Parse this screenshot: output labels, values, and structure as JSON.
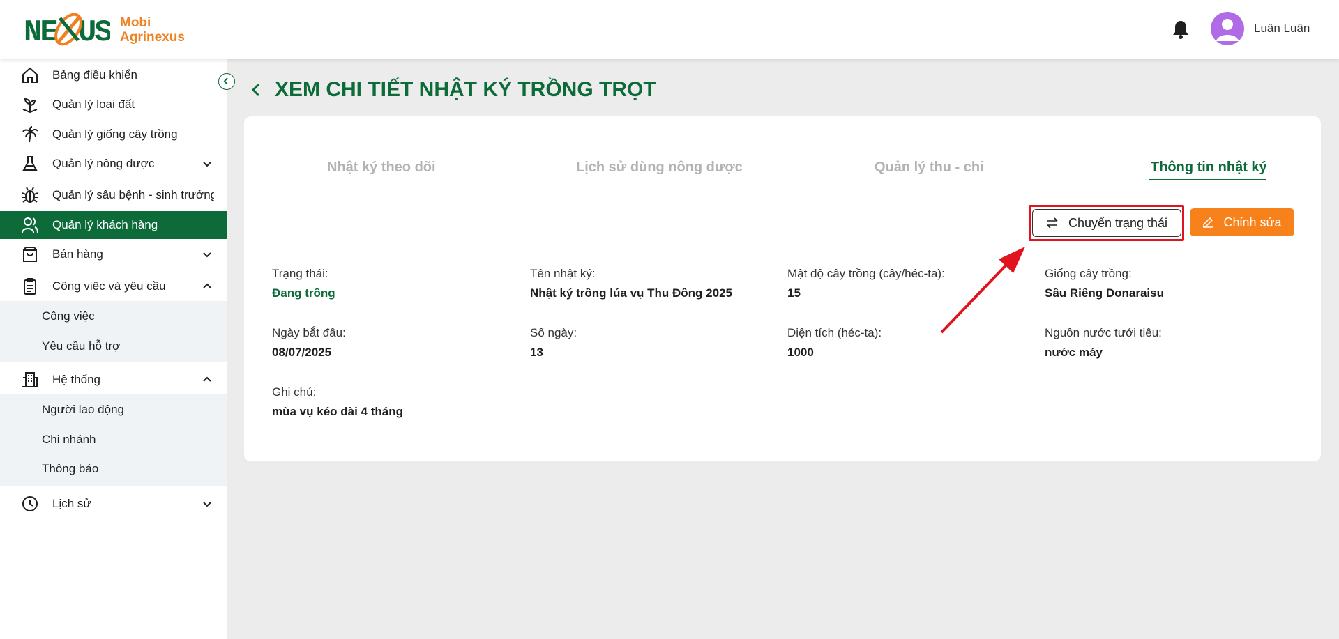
{
  "brand": {
    "name_line1": "Mobi",
    "name_line2": "Agrinexus",
    "logo_text": "NEXUS"
  },
  "user": {
    "name": "Luân Luân"
  },
  "sidebar": {
    "items": [
      {
        "label": "Bảng điều khiển",
        "icon": "home-icon"
      },
      {
        "label": "Quản lý loại đất",
        "icon": "sprout-icon"
      },
      {
        "label": "Quản lý giống cây trồng",
        "icon": "palm-tree-icon"
      },
      {
        "label": "Quản lý nông dược",
        "icon": "flask-icon",
        "has_children": true
      },
      {
        "label": "Quản lý sâu bệnh - sinh trưởng",
        "icon": "bug-icon"
      },
      {
        "label": "Quản lý khách hàng",
        "icon": "users-icon",
        "active": true
      },
      {
        "label": "Bán hàng",
        "icon": "shopping-bag-icon",
        "has_children": true
      },
      {
        "label": "Công việc và yêu cầu",
        "icon": "clipboard-icon",
        "expanded": true,
        "children": [
          "Công việc",
          "Yêu cầu hỗ trợ"
        ]
      },
      {
        "label": "Hệ thống",
        "icon": "building-icon",
        "expanded": true,
        "children": [
          "Người lao động",
          "Chi nhánh",
          "Thông báo"
        ]
      },
      {
        "label": "Lịch sử",
        "icon": "history-icon",
        "has_children": true
      }
    ]
  },
  "page": {
    "title": "XEM CHI TIẾT NHẬT KÝ TRỒNG TRỌT"
  },
  "tabs": [
    {
      "label": "Nhật ký theo dõi",
      "active": false
    },
    {
      "label": "Lịch sử dùng nông dược",
      "active": false
    },
    {
      "label": "Quản lý thu - chi",
      "active": false
    },
    {
      "label": "Thông tin nhật ký",
      "active": true
    }
  ],
  "actions": {
    "change_status": "Chuyển trạng thái",
    "edit": "Chỉnh sửa"
  },
  "details": {
    "status": {
      "label": "Trạng thái:",
      "value": "Đang trồng"
    },
    "journal_name": {
      "label": "Tên nhật ký:",
      "value": "Nhật ký trồng lúa vụ Thu Đông 2025"
    },
    "density": {
      "label": "Mật độ cây trồng (cây/héc-ta):",
      "value": "15"
    },
    "variety": {
      "label": "Giống cây trồng:",
      "value": "Sầu Riêng Donaraisu"
    },
    "start_date": {
      "label": "Ngày bắt đầu:",
      "value": "08/07/2025"
    },
    "days": {
      "label": "Số ngày:",
      "value": "13"
    },
    "area": {
      "label": "Diện tích (héc-ta):",
      "value": "1000"
    },
    "water_source": {
      "label": "Nguồn nước tưới tiêu:",
      "value": "nước máy"
    },
    "note": {
      "label": "Ghi chú:",
      "value": "mùa vụ kéo dài 4 tháng"
    }
  },
  "colors": {
    "primary": "#0d6b3a",
    "accent": "#f7821b",
    "highlight": "#e0141e",
    "avatar": "#b06be6"
  }
}
